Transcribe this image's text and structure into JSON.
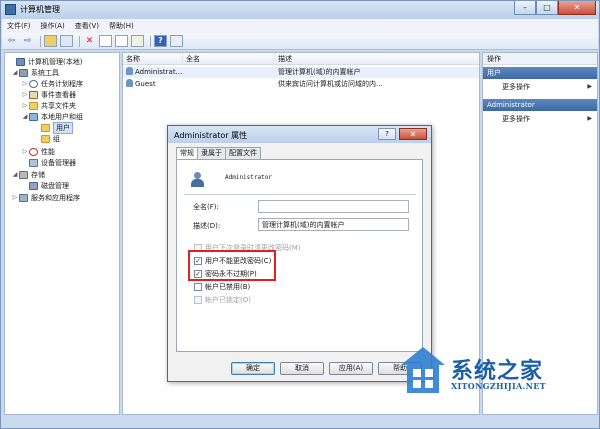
{
  "window": {
    "title": "计算机管理",
    "controls": [
      "–",
      "□",
      "✕"
    ]
  },
  "menu": [
    "文件(F)",
    "操作(A)",
    "查看(V)",
    "帮助(H)"
  ],
  "toolbar": {
    "back": "⇦",
    "forward": "⇨",
    "delete": "✕",
    "help": "?"
  },
  "tree": {
    "root": "计算机管理(本地)",
    "system_tools": "系统工具",
    "task_scheduler": "任务计划程序",
    "event_viewer": "事件查看器",
    "shared_folders": "共享文件夹",
    "local_users": "本地用户和组",
    "users": "用户",
    "groups": "组",
    "performance": "性能",
    "device_manager": "设备管理器",
    "storage": "存储",
    "disk_management": "磁盘管理",
    "services": "服务和应用程序"
  },
  "list": {
    "columns": {
      "name": "名称",
      "fullname": "全名",
      "description": "描述"
    },
    "rows": [
      {
        "name": "Administrat...",
        "fullname": "",
        "description": "管理计算机(域)的内置帐户"
      },
      {
        "name": "Guest",
        "fullname": "",
        "description": "供来宾访问计算机或访问域的内..."
      }
    ]
  },
  "actions": {
    "header": "操作",
    "group1": "用户",
    "group1_more": "更多操作",
    "group2": "Administrator",
    "group2_more": "更多操作",
    "arrow": "▶"
  },
  "dialog": {
    "title": "Administrator 属性",
    "help": "?",
    "close": "✕",
    "tabs": [
      "常规",
      "隶属于",
      "配置文件"
    ],
    "username": "Administrator",
    "fullname_label": "全名(F):",
    "fullname_value": "",
    "desc_label": "描述(D):",
    "desc_value": "管理计算机(域)的内置帐户",
    "checkboxes": [
      {
        "label": "用户下次登录时须更改密码(M)",
        "checked": false,
        "disabled": true
      },
      {
        "label": "用户不能更改密码(C)",
        "checked": true,
        "disabled": false
      },
      {
        "label": "密码永不过期(P)",
        "checked": true,
        "disabled": false
      },
      {
        "label": "帐户已禁用(B)",
        "checked": false,
        "disabled": false
      },
      {
        "label": "帐户已锁定(O)",
        "checked": false,
        "disabled": true
      }
    ],
    "check_mark": "✓",
    "buttons": {
      "ok": "确定",
      "cancel": "取消",
      "apply": "应用(A)",
      "help": "帮助"
    }
  },
  "watermark": {
    "main": "系统之家",
    "sub": "XITONGZHIJIA.NET"
  }
}
